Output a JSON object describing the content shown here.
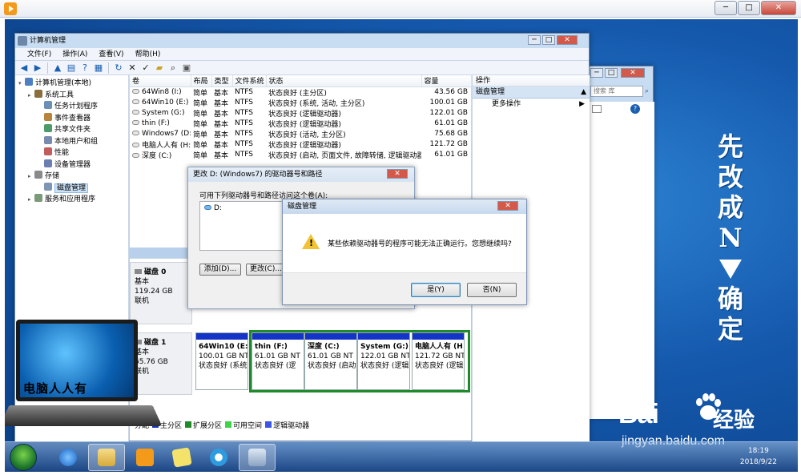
{
  "computer_mgmt": {
    "title": "计算机管理",
    "menu": [
      "文件(F)",
      "操作(A)",
      "查看(V)",
      "帮助(H)"
    ],
    "tree": [
      {
        "label": "计算机管理(本地)",
        "level": 0
      },
      {
        "label": "系统工具",
        "level": 1
      },
      {
        "label": "任务计划程序",
        "level": 2
      },
      {
        "label": "事件查看器",
        "level": 2
      },
      {
        "label": "共享文件夹",
        "level": 2
      },
      {
        "label": "本地用户和组",
        "level": 2
      },
      {
        "label": "性能",
        "level": 2
      },
      {
        "label": "设备管理器",
        "level": 2
      },
      {
        "label": "存储",
        "level": 1
      },
      {
        "label": "磁盘管理",
        "level": 2,
        "selected": true
      },
      {
        "label": "服务和应用程序",
        "level": 1
      }
    ],
    "volume_headers": [
      "卷",
      "布局",
      "类型",
      "文件系统",
      "状态",
      "容量"
    ],
    "volumes": [
      [
        "64Win8 (I:)",
        "简单",
        "基本",
        "NTFS",
        "状态良好 (主分区)",
        "43.56 GB"
      ],
      [
        "64Win10 (E:)",
        "简单",
        "基本",
        "NTFS",
        "状态良好 (系统, 活动, 主分区)",
        "100.01 GB"
      ],
      [
        "System (G:)",
        "简单",
        "基本",
        "NTFS",
        "状态良好 (逻辑驱动器)",
        "122.01 GB"
      ],
      [
        "thin (F:)",
        "简单",
        "基本",
        "NTFS",
        "状态良好 (逻辑驱动器)",
        "61.01 GB"
      ],
      [
        "Windows7 (D:)",
        "简单",
        "基本",
        "NTFS",
        "状态良好 (活动, 主分区)",
        "75.68 GB"
      ],
      [
        "电脑人人有 (H:)",
        "简单",
        "基本",
        "NTFS",
        "状态良好 (逻辑驱动器)",
        "121.72 GB"
      ],
      [
        "深度 (C:)",
        "简单",
        "基本",
        "NTFS",
        "状态良好 (启动, 页面文件, 故障转储, 逻辑驱动器)",
        "61.01 GB"
      ]
    ],
    "disk0": {
      "name": "磁盘 0",
      "type": "基本",
      "size": "119.24 GB",
      "status": "联机"
    },
    "disk1": {
      "name": "磁盘 1",
      "type": "基本",
      "size": "65.76 GB",
      "status": "联机",
      "partitions": [
        {
          "name": "64Win10 (E:)",
          "size": "100.01 GB NT",
          "status": "状态良好 (系统"
        },
        {
          "name": "thin (F:)",
          "size": "61.01 GB NT",
          "status": "状态良好 (逻"
        },
        {
          "name": "深度 (C:)",
          "size": "61.01 GB NT",
          "status": "状态良好 (启动"
        },
        {
          "name": "System (G:)",
          "size": "122.01 GB NT",
          "status": "状态良好 (逻辑"
        },
        {
          "name": "电脑人人有 (H",
          "size": "121.72 GB NT",
          "status": "状态良好 (逻辑"
        }
      ]
    },
    "legend": [
      {
        "label": "分配",
        "color": "#000000"
      },
      {
        "label": "主分区",
        "color": "#1433c7"
      },
      {
        "label": "扩展分区",
        "color": "#1f8a2a"
      },
      {
        "label": "可用空间",
        "color": "#3fd24a"
      },
      {
        "label": "逻辑驱动器",
        "color": "#3a56e8"
      }
    ],
    "actions": {
      "header": "操作",
      "section": "磁盘管理",
      "item": "更多操作"
    }
  },
  "bg_window": {
    "search_placeholder": "搜索 库"
  },
  "drive_dialog": {
    "title": "更改 D: (Windows7) 的驱动器号和路径",
    "prompt": "可用下列驱动器号和路径访问这个卷(A):",
    "list_item": "D:",
    "add_button": "添加(D)...",
    "change_button": "更改(C)..."
  },
  "warning_dialog": {
    "title": "磁盘管理",
    "message": "某些依赖驱动器号的程序可能无法正确运行。您想继续吗?",
    "yes_button": "是(Y)",
    "no_button": "否(N)"
  },
  "overlay": {
    "side_text_top": "先改成",
    "side_text_n": "N",
    "side_text_bottom": "确定",
    "laptop_caption": "电脑人人有",
    "watermark_logo": "Bai",
    "watermark_brand": "经验",
    "watermark_url": "jingyan.baidu.com"
  },
  "taskbar": {
    "time": "18:19",
    "date": "2018/9/22"
  },
  "colors": {
    "primary_partition": "#1433c7",
    "extended_partition": "#1f8a2a",
    "desktop": "#1559ad",
    "warning": "#f1c232"
  }
}
